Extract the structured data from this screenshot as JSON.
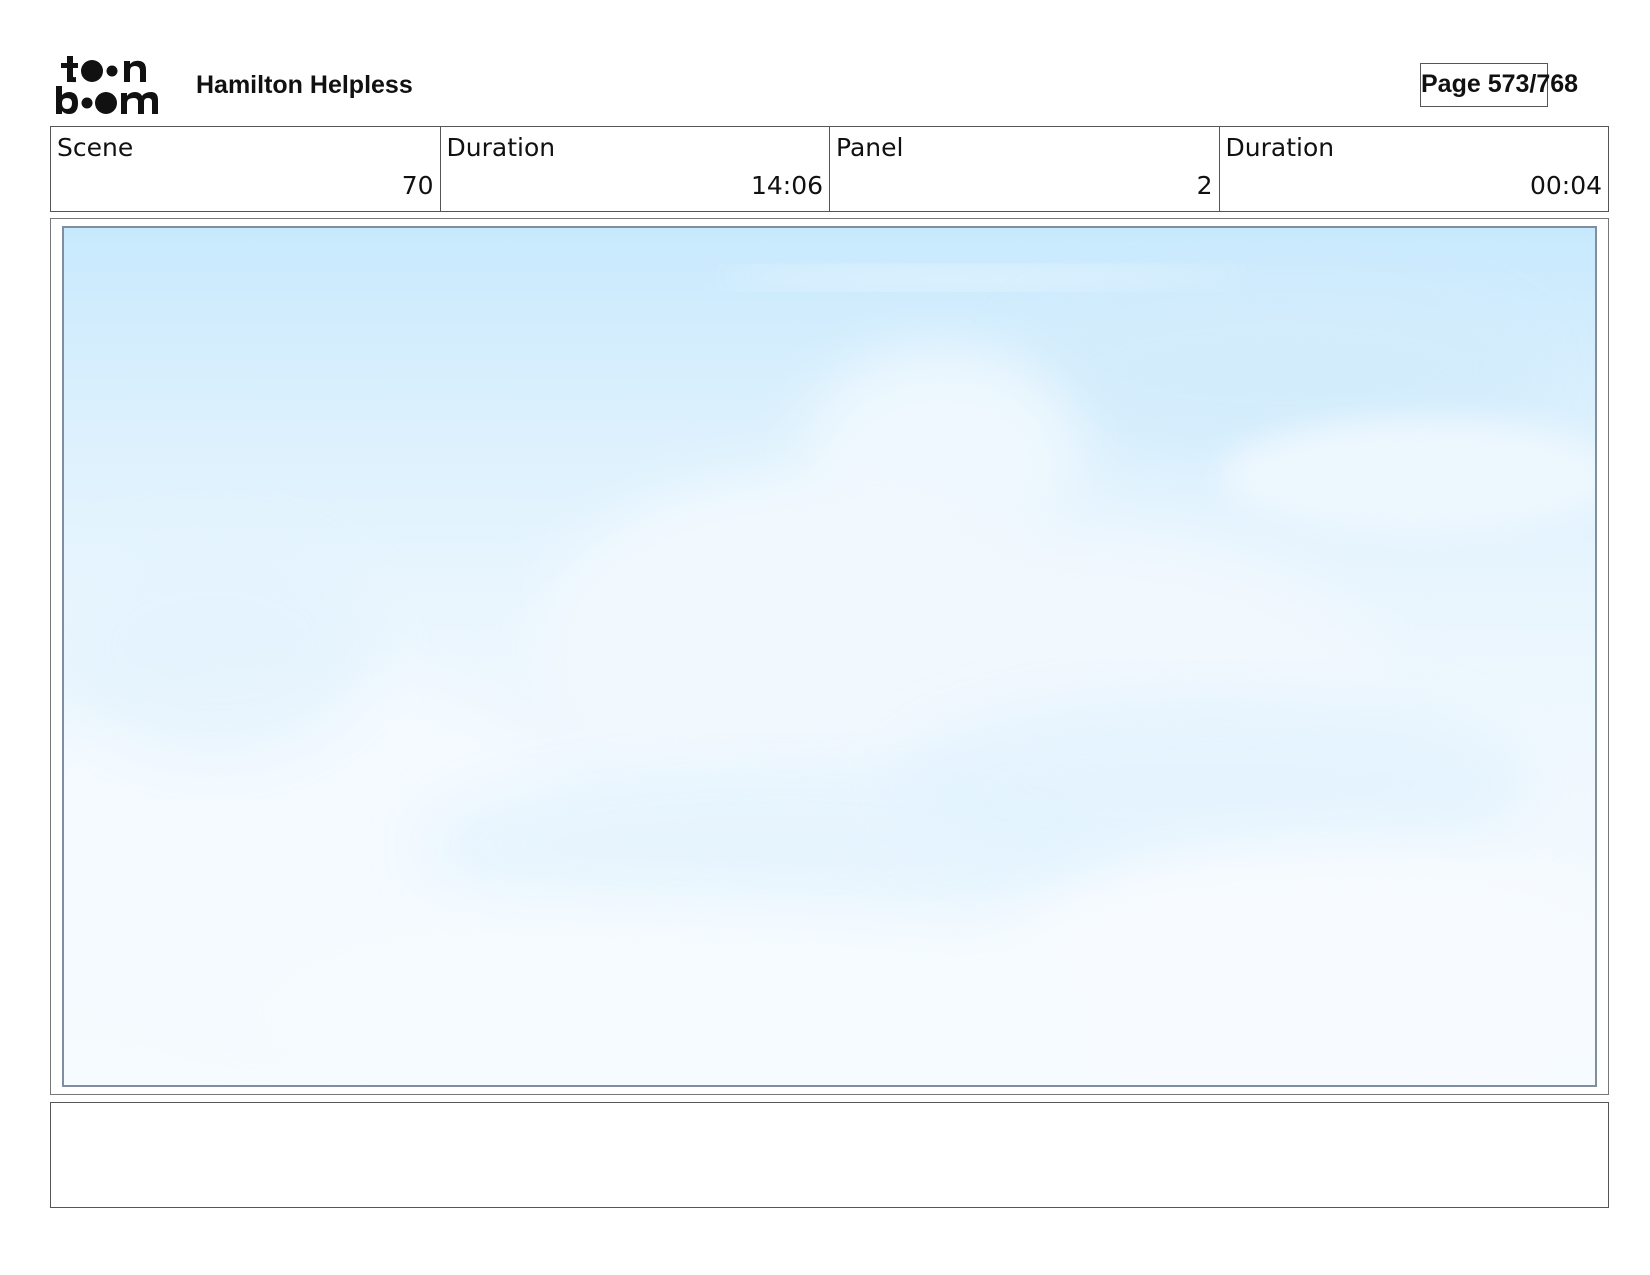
{
  "header": {
    "logo_text": "toon boom",
    "project_title": "Hamilton Helpless",
    "page_indicator": "Page 573/768"
  },
  "info": {
    "scene_label": "Scene",
    "scene_value": "70",
    "scene_duration_label": "Duration",
    "scene_duration_value": "14:06",
    "panel_label": "Panel",
    "panel_value": "2",
    "panel_duration_label": "Duration",
    "panel_duration_value": "00:04"
  },
  "panel": {
    "image_subject": "sky-with-clouds",
    "sky_color_top": "#c8e9fd",
    "sky_color_bottom": "#f6fbff"
  },
  "notes": {
    "text": ""
  }
}
